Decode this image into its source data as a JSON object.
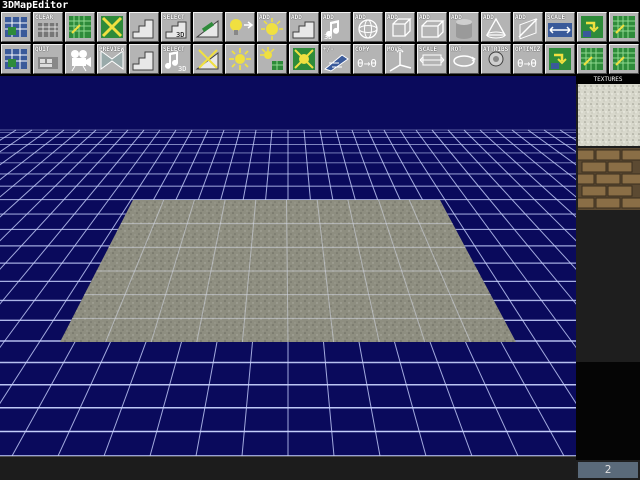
{
  "window": {
    "title": "3DMapEditor"
  },
  "toolbar": {
    "row1": [
      {
        "id": "map-wall",
        "label": "",
        "icon": "grid-wall-icon"
      },
      {
        "id": "clear",
        "label": "CLEAR",
        "icon": "clear-icon"
      },
      {
        "id": "green-grid",
        "label": "",
        "icon": "green-grid-icon"
      },
      {
        "id": "delete",
        "label": "",
        "icon": "cross-delete-icon"
      },
      {
        "id": "stairs",
        "label": "",
        "icon": "stairs-icon"
      },
      {
        "id": "select-3d",
        "label": "SELECT",
        "icon": "select-3d-icon"
      },
      {
        "id": "ramp",
        "label": "",
        "icon": "ramp-icon"
      },
      {
        "id": "light-bulb",
        "label": "",
        "icon": "light-bulb-icon"
      },
      {
        "id": "add-light",
        "label": "ADD",
        "icon": "add-light-icon"
      },
      {
        "id": "add-object",
        "label": "ADD",
        "icon": "add-object-icon"
      },
      {
        "id": "add-sound",
        "label": "ADD",
        "icon": "add-sound-icon"
      },
      {
        "id": "add-sphere",
        "label": "ADD",
        "icon": "sphere-icon"
      },
      {
        "id": "add-cube",
        "label": "ADD",
        "icon": "cube-icon"
      },
      {
        "id": "add-box",
        "label": "ADD",
        "icon": "box-icon"
      },
      {
        "id": "add-cylinder",
        "label": "ADD",
        "icon": "cylinder-icon"
      },
      {
        "id": "add-cone",
        "label": "ADD",
        "icon": "cone-icon"
      },
      {
        "id": "add-plane",
        "label": "ADD",
        "icon": "plane-icon"
      },
      {
        "id": "scale-xyz",
        "label": "SCALE",
        "icon": "scale-arrows-icon"
      },
      {
        "id": "texture-apply",
        "label": "",
        "icon": "texture-apply-icon"
      },
      {
        "id": "grid-map",
        "label": "",
        "icon": "grid-map-icon"
      }
    ],
    "row2": [
      {
        "id": "load",
        "label": "",
        "icon": "grid-wall-icon"
      },
      {
        "id": "quit",
        "label": "QUIT",
        "icon": "quit-icon"
      },
      {
        "id": "camera",
        "label": "",
        "icon": "camera-icon"
      },
      {
        "id": "preview",
        "label": "PREVIEW",
        "icon": "preview-icon"
      },
      {
        "id": "stairs-3d",
        "label": "",
        "icon": "stairs-icon"
      },
      {
        "id": "select-sound",
        "label": "SELECT",
        "icon": "select-sound-icon"
      },
      {
        "id": "no-ramp",
        "label": "",
        "icon": "no-ramp-icon"
      },
      {
        "id": "sun",
        "label": "",
        "icon": "sun-icon"
      },
      {
        "id": "sun-grid",
        "label": "",
        "icon": "sun-grid-icon"
      },
      {
        "id": "no-light",
        "label": "",
        "icon": "no-light-icon"
      },
      {
        "id": "plus-minus",
        "label": "+/-",
        "icon": "plus-minus-icon"
      },
      {
        "id": "copy",
        "label": "COPY",
        "icon": "copy-icon"
      },
      {
        "id": "move",
        "label": "MOVE",
        "icon": "move-axes-icon"
      },
      {
        "id": "scale",
        "label": "SCALE",
        "icon": "scale-icon"
      },
      {
        "id": "rotate",
        "label": "ROT",
        "icon": "rotate-icon"
      },
      {
        "id": "attribs",
        "label": "ATTRIBS",
        "icon": "attribs-icon"
      },
      {
        "id": "optimize",
        "label": "OPTIMIZ",
        "icon": "optimize-icon"
      },
      {
        "id": "texture-pick",
        "label": "",
        "icon": "texture-pick-icon"
      },
      {
        "id": "grid-map-2",
        "label": "",
        "icon": "grid-map-icon"
      },
      {
        "id": "grid-map-3",
        "label": "",
        "icon": "grid-map-icon"
      }
    ],
    "sublabels": {
      "scale_xyz": "XYZ",
      "rot_xyz": "XYZ",
      "fx": "FX",
      "thirty_d": "3D"
    }
  },
  "textures": {
    "header": "TEXTURES",
    "items": [
      {
        "name": "concrete",
        "icon": "concrete-texture"
      },
      {
        "name": "brick",
        "icon": "brick-texture"
      }
    ],
    "page": "2"
  },
  "colors": {
    "sky": "#0a0a5c",
    "grid_line": "#c8d2ff",
    "floor": "#8e8e80",
    "toolbar_button": "#b4b4b4",
    "accent_green": "#2e8b3a",
    "accent_yellow": "#f0e040"
  }
}
